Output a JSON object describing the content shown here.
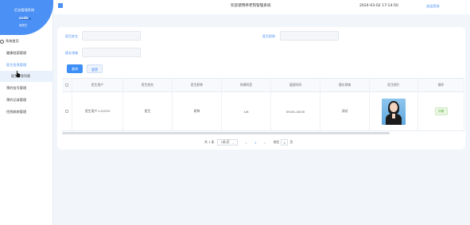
{
  "sidebar": {
    "system_title": "后台管理系统",
    "role_name": "sudo",
    "role_sub": "管理员",
    "menu": [
      {
        "label": "系统首页"
      },
      {
        "label": "健康档案管理"
      },
      {
        "label": "医生信息管理"
      },
      {
        "label": "医生信息列表"
      },
      {
        "label": "预约挂号管理"
      },
      {
        "label": "预约记录管理"
      },
      {
        "label": "住院病房管理"
      }
    ]
  },
  "header": {
    "welcome": "欢迎使用养老院管理系统",
    "datetime": "2024-03-02 17:14:50",
    "logout": "退出登录"
  },
  "filters": {
    "label_1": "医生姓名",
    "label_2": "医生职称",
    "label_3": "擅长领域",
    "search_button": "查询",
    "reset_button": "重置"
  },
  "table": {
    "headers": [
      "医生用户",
      "医生姓名",
      "医生职称",
      "所属科室",
      "值班时间",
      "擅长领域",
      "医生照片",
      "操作"
    ],
    "rows": [
      {
        "user": "医生用户-112233",
        "name": "医生",
        "title": "职称",
        "dept": "1/6",
        "time": "09:00-18:00",
        "field": "测试",
        "action": "详情"
      }
    ]
  },
  "pagination": {
    "total": "共 1 条",
    "page_size": "1条/页",
    "prev": "<",
    "current": "1",
    "next": ">",
    "goto_label": "前往",
    "goto_value": "1",
    "page_suffix": "页"
  },
  "colors": {
    "accent": "#4a90f5",
    "sidebar_head": "#4a90f5"
  }
}
